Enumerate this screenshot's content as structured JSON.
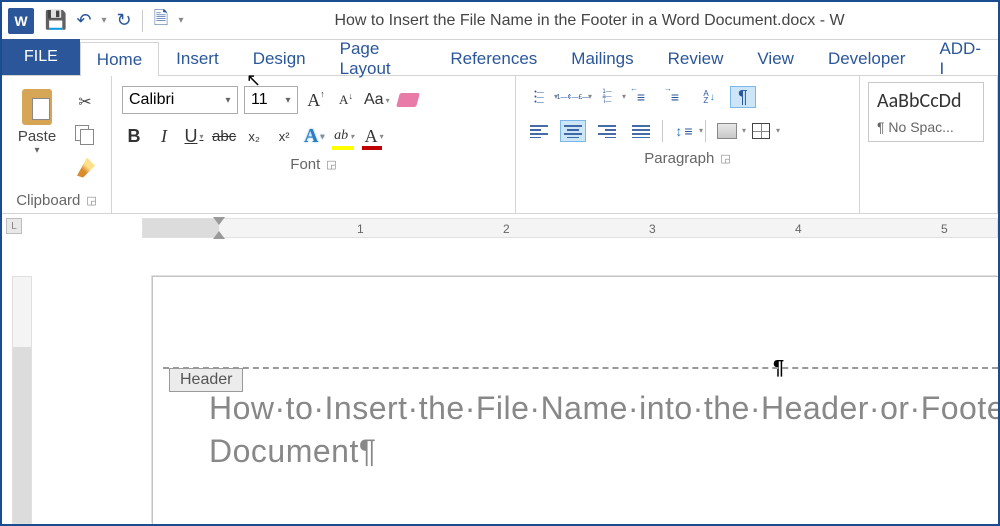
{
  "title": "How to Insert the File Name in the Footer in a Word Document.docx - W",
  "tabs": {
    "file": "FILE",
    "list": [
      "Home",
      "Insert",
      "Design",
      "Page Layout",
      "References",
      "Mailings",
      "Review",
      "View",
      "Developer",
      "ADD-I"
    ],
    "active": "Home",
    "hovered": "Insert"
  },
  "clipboard": {
    "paste": "Paste",
    "group": "Clipboard"
  },
  "font": {
    "name": "Calibri",
    "size": "11",
    "case": "Aa",
    "group": "Font"
  },
  "paragraph": {
    "group": "Paragraph"
  },
  "styles": {
    "sample": "AaBbCcDd",
    "name": "¶ No Spac..."
  },
  "ruler": {
    "ticks": [
      "1",
      "2",
      "3",
      "4",
      "5"
    ]
  },
  "document": {
    "header_tag": "Header",
    "cursor_glyph": "¶",
    "line1": "How·to·Insert·the·File·Name·into·the·Header·or·Foote",
    "line2": "Document¶"
  }
}
